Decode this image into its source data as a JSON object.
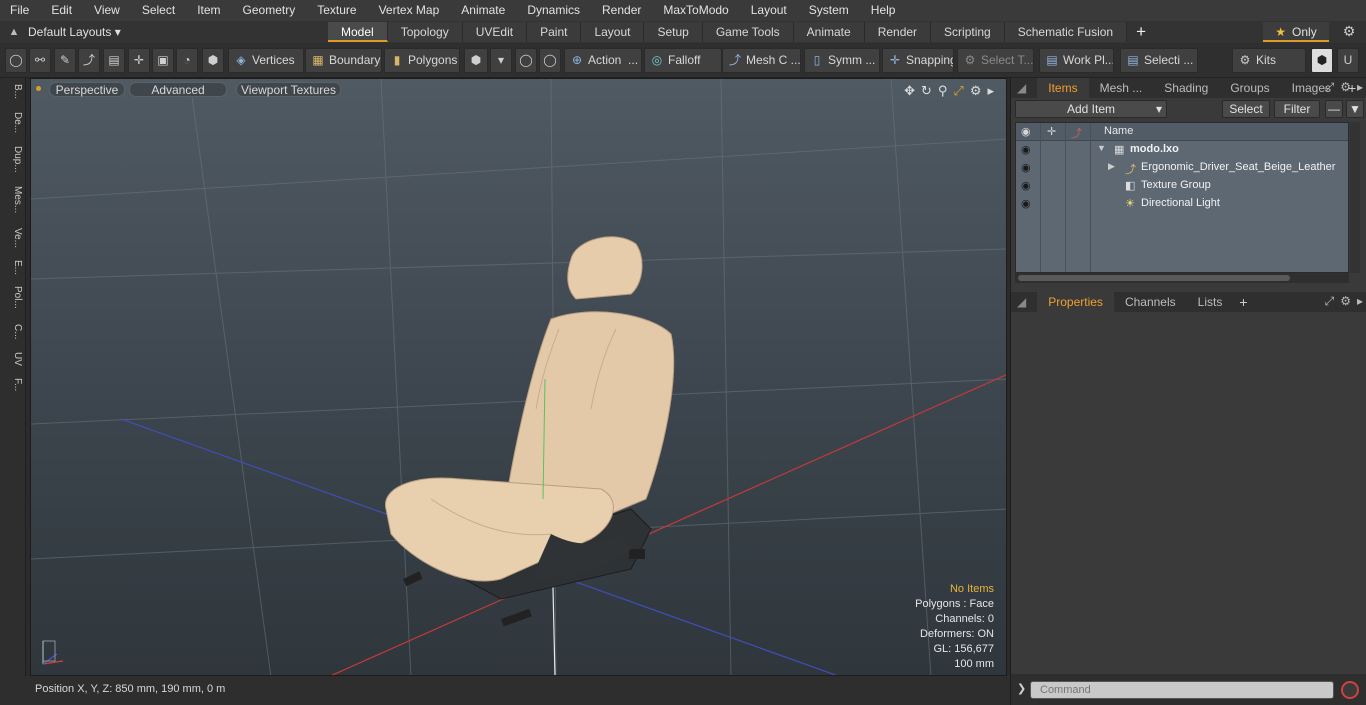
{
  "menubar": {
    "items": [
      "File",
      "Edit",
      "View",
      "Select",
      "Item",
      "Geometry",
      "Texture",
      "Vertex Map",
      "Animate",
      "Dynamics",
      "Render",
      "MaxToModo",
      "Layout",
      "System",
      "Help"
    ]
  },
  "layoutbar": {
    "layout_selector": "Default Layouts ▾",
    "tabs": [
      "Model",
      "Topology",
      "UVEdit",
      "Paint",
      "Layout",
      "Setup",
      "Game Tools",
      "Animate",
      "Render",
      "Scripting",
      "Schematic Fusion"
    ],
    "active_tab": "Model",
    "only_label": "Only"
  },
  "toolbar": {
    "vertices": "Vertices",
    "boundary": "Boundary",
    "polygons": "Polygons",
    "action": "Action",
    "falloff": "Falloff",
    "mesh_c": "Mesh C ...",
    "symm": "Symm ...",
    "snapping": "Snapping",
    "select_t": "Select T...",
    "work_pl": "Work Pl...",
    "selecti": "Selecti ...",
    "kits": "Kits"
  },
  "left_strip": {
    "items": [
      "B...",
      "De...",
      "Dup...",
      "Mes...",
      "Ve...",
      "E...",
      "Pol...",
      "C...",
      "UV",
      "F..."
    ]
  },
  "viewport": {
    "tabs": [
      "Perspective",
      "Advanced",
      "Viewport Textures"
    ],
    "hud": {
      "no_items": "No Items",
      "polygons": "Polygons : Face",
      "channels": "Channels: 0",
      "deformers": "Deformers: ON",
      "gl": "GL: 156,677",
      "scale": "100 mm"
    }
  },
  "statusbar": {
    "position": "Position X, Y, Z:   850 mm, 190 mm, 0 m"
  },
  "items_panel": {
    "tabs": [
      "Items",
      "Mesh ...",
      "Shading",
      "Groups",
      "Images"
    ],
    "active_tab": "Items",
    "add_item": "Add Item",
    "select": "Select",
    "filter": "Filter",
    "column_name": "Name",
    "tree": [
      {
        "label": "modo.lxo",
        "bold": true
      },
      {
        "label": "Ergonomic_Driver_Seat_Beige_Leather",
        "bold": false
      },
      {
        "label": "Texture Group",
        "bold": false
      },
      {
        "label": "Directional Light",
        "bold": false
      }
    ]
  },
  "properties_panel": {
    "tabs": [
      "Properties",
      "Channels",
      "Lists"
    ],
    "active_tab": "Properties"
  },
  "command_bar": {
    "placeholder": "Command"
  },
  "colors": {
    "accent": "#e09a2a",
    "seat_leather": "#e4c9a8",
    "seat_base": "#2e3235"
  }
}
